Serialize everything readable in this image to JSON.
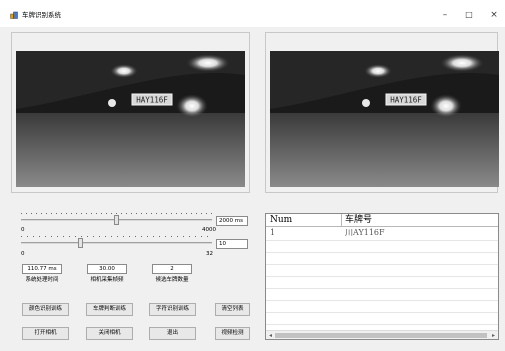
{
  "window": {
    "title": "车牌识别系统",
    "controls": {
      "minimize": "–",
      "maximize": "□",
      "close": "×"
    }
  },
  "sliders": [
    {
      "min_label": "0",
      "max_label": "4000",
      "value_text": "2000 ms",
      "fraction": 0.5
    },
    {
      "min_label": "0",
      "max_label": "32",
      "value_text": "10",
      "fraction": 0.31
    }
  ],
  "readouts": [
    {
      "value": "110.77 ms",
      "label": "系统处理时间"
    },
    {
      "value": "30.00",
      "label": "相机采集帧频"
    },
    {
      "value": "2",
      "label": "候选车牌数量"
    }
  ],
  "buttons": {
    "row1": [
      "颜色识别训练",
      "车牌判断训练",
      "字符识别训练",
      "清空列表"
    ],
    "row2": [
      "打开相机",
      "关闭相机",
      "退出",
      "视频检测"
    ]
  },
  "list": {
    "columns": [
      "Num",
      "车牌号"
    ],
    "rows": [
      {
        "num": "1",
        "plate": "川AY116F"
      }
    ]
  },
  "images": {
    "left_plate_text": "HAY116F",
    "right_plate_text": "HAY116F"
  },
  "colors": {
    "window_bg": "#f0f0f0",
    "image_bg": "#2c2c2c",
    "plate_bg": "#d8d8d8"
  }
}
